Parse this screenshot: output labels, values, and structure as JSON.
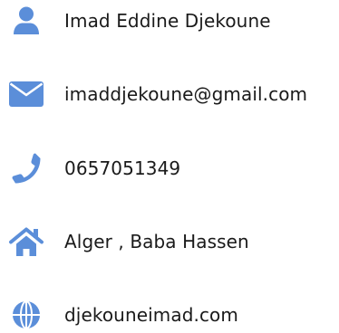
{
  "colors": {
    "icon": "#5b8ed9",
    "text": "#1a1a1a",
    "background": "#ffffff"
  },
  "contact": {
    "items": [
      {
        "icon": "user-icon",
        "label": "Imad Eddine Djekoune"
      },
      {
        "icon": "envelope-icon",
        "label": "imaddjekoune@gmail.com"
      },
      {
        "icon": "phone-icon",
        "label": "0657051349"
      },
      {
        "icon": "home-icon",
        "label": "Alger , Baba Hassen"
      },
      {
        "icon": "globe-icon",
        "label": "djekouneimad.com"
      }
    ]
  }
}
